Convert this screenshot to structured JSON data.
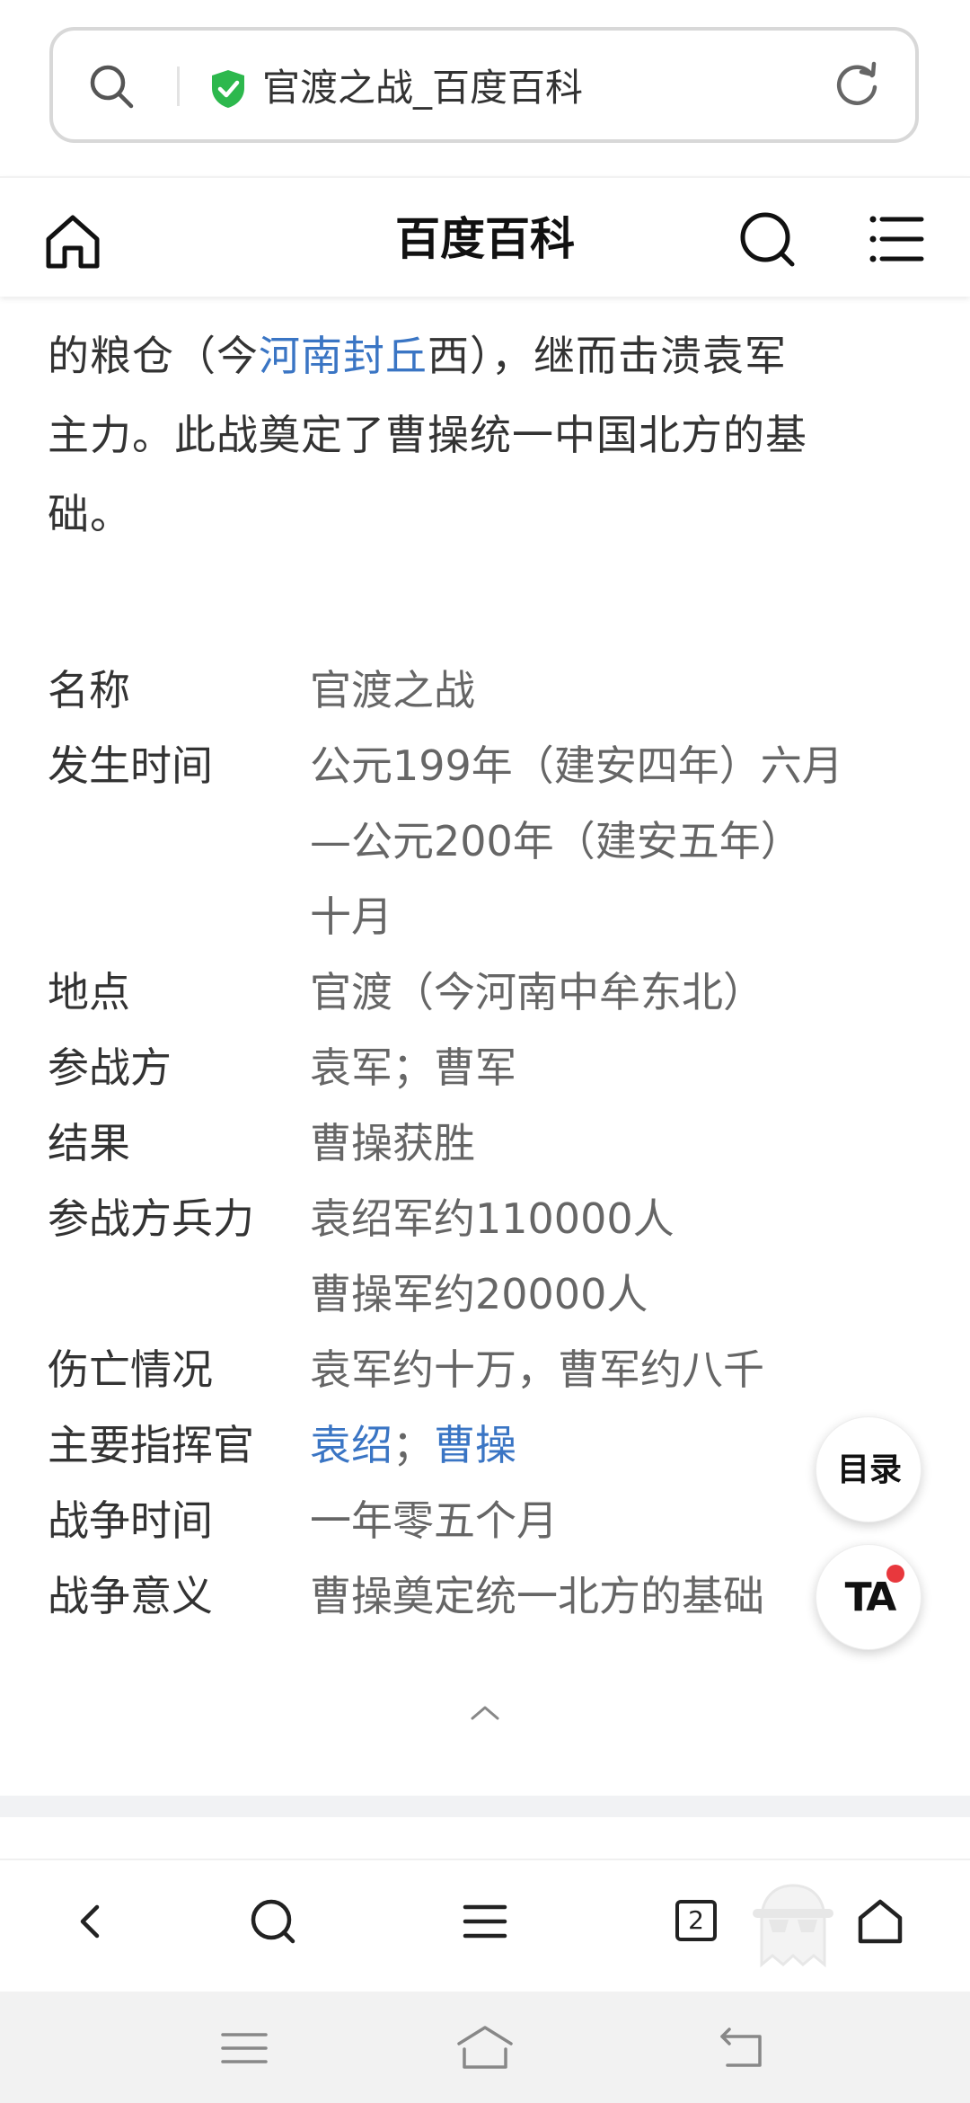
{
  "address_bar": {
    "url_text": "官渡之战_百度百科"
  },
  "site_header": {
    "title": "百度百科"
  },
  "intro": {
    "line1_part1": "的粮仓（今",
    "line1_link": "河南封丘",
    "line1_part2": "西），继而击溃袁军",
    "line2": "主力。此战奠定了曹操统一中国北方的基",
    "line3": "础。"
  },
  "infobox": {
    "rows": [
      {
        "label": "名称",
        "value": [
          "官渡之战"
        ]
      },
      {
        "label": "发生时间",
        "value": [
          "公元199年（建安四年）六月",
          "—公元200年（建安五年）",
          "十月"
        ]
      },
      {
        "label": "地点",
        "value": [
          "官渡（今河南中牟东北）"
        ]
      },
      {
        "label": "参战方",
        "value": [
          "袁军；曹军"
        ]
      },
      {
        "label": "结果",
        "value": [
          "曹操获胜"
        ]
      },
      {
        "label": "参战方兵力",
        "value": [
          "袁绍军约110000人",
          "曹操军约20000人"
        ]
      },
      {
        "label": "伤亡情况",
        "value": [
          "袁军约十万，曹军约八千"
        ]
      },
      {
        "label": "主要指挥官",
        "links": [
          "袁绍",
          "曹操"
        ],
        "separator": "；"
      },
      {
        "label": "战争时间",
        "value": [
          "一年零五个月"
        ]
      },
      {
        "label": "战争意义",
        "value": [
          "曹操奠定统一北方的基础"
        ]
      }
    ]
  },
  "floating": {
    "toc_label": "目录",
    "ta_label": "TA"
  },
  "toolbar": {
    "tab_count": "2"
  },
  "colors": {
    "link": "#3a75c4",
    "shield": "#2db84d",
    "badge_dot": "#e8383d"
  }
}
